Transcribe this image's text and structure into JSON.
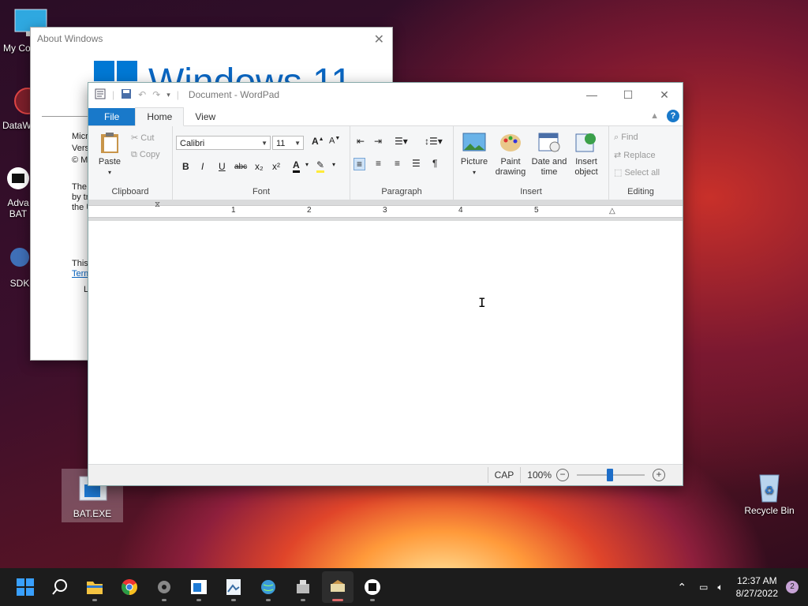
{
  "desktop": {
    "icons": [
      {
        "label": "My Co"
      },
      {
        "label": "DataW"
      },
      {
        "label": "Adva BAT"
      },
      {
        "label": "SDK"
      },
      {
        "label": "BAT.EXE"
      },
      {
        "label": "Recycle Bin"
      }
    ]
  },
  "about": {
    "title": "About Windows",
    "logo_text": "Windows 11",
    "lines": [
      "Micro",
      "Versi",
      "© M",
      "The",
      "by tr",
      "the U",
      "This",
      "Term",
      "L"
    ]
  },
  "wordpad": {
    "title": "Document - WordPad",
    "tabs": {
      "file": "File",
      "home": "Home",
      "view": "View"
    },
    "help": "?",
    "clipboard": {
      "paste": "Paste",
      "cut": "Cut",
      "copy": "Copy",
      "group": "Clipboard"
    },
    "font": {
      "family": "Calibri",
      "size": "11",
      "group": "Font",
      "bold": "B",
      "italic": "I",
      "underline": "U",
      "strike": "abc",
      "sub": "x₂",
      "sup": "x²",
      "color": "A"
    },
    "paragraph": {
      "group": "Paragraph"
    },
    "insert": {
      "picture": "Picture",
      "paint1": "Paint",
      "paint2": "drawing",
      "date1": "Date and",
      "date2": "time",
      "obj1": "Insert",
      "obj2": "object",
      "group": "Insert"
    },
    "editing": {
      "find": "Find",
      "replace": "Replace",
      "select_all": "Select all",
      "group": "Editing"
    },
    "ruler": {
      "numbers": [
        "1",
        "2",
        "3",
        "4",
        "5"
      ]
    },
    "status": {
      "caps": "CAP",
      "zoom": "100%",
      "zoom_level": 1.0
    }
  },
  "taskbar": {
    "time": "12:37 AM",
    "date": "8/27/2022",
    "notifications": "2"
  },
  "colors": {
    "accent": "#1979ca",
    "taskbar": "#1c1c1c"
  }
}
